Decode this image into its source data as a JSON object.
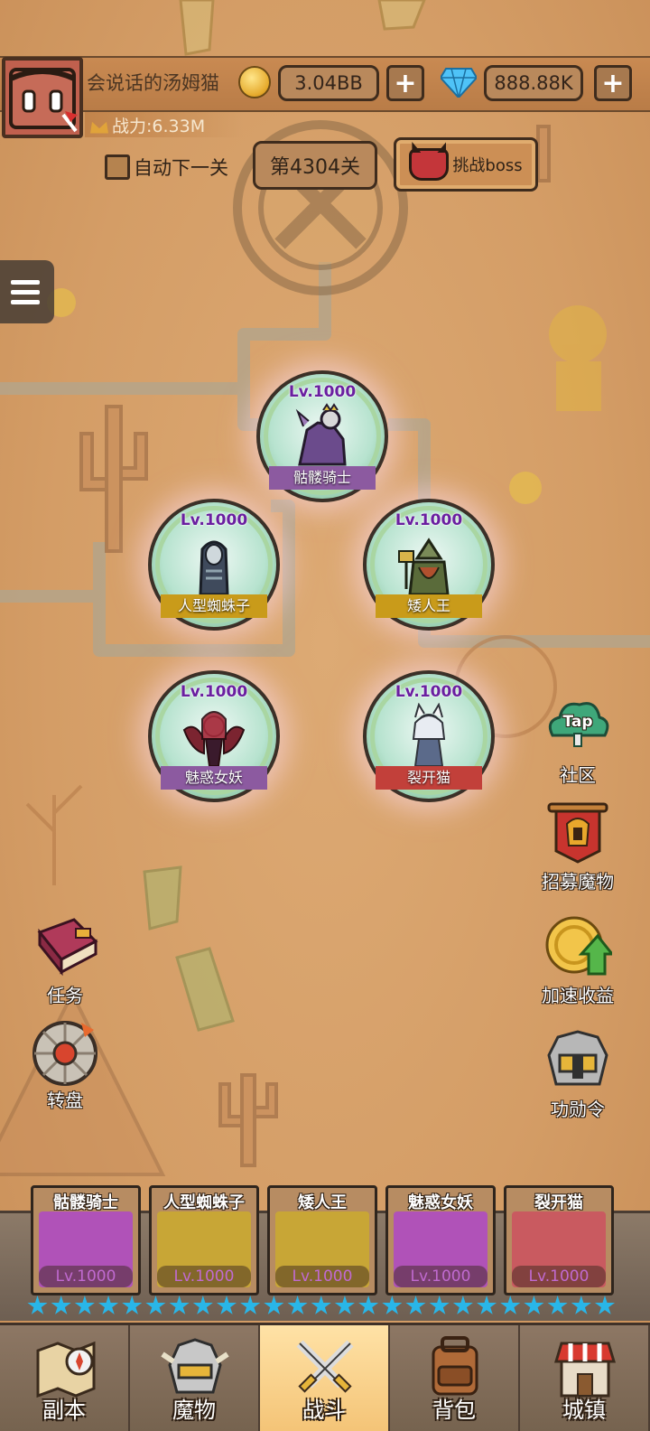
{
  "player": {
    "name": "会说话的汤姆猫",
    "power": "战力:6.33M",
    "gold": "3.04BB",
    "gems": "888.88K",
    "plus": "+"
  },
  "stage": {
    "auto_next_label": "自动下一关",
    "current": "第4304关",
    "boss_label": "挑战boss"
  },
  "heroes": [
    {
      "level": "Lv.1000",
      "name": "骷髅骑士",
      "banner_color": "#8c5aa0"
    },
    {
      "level": "Lv.1000",
      "name": "人型蜘蛛子",
      "banner_color": "#c99b1a"
    },
    {
      "level": "Lv.1000",
      "name": "矮人王",
      "banner_color": "#c99b1a"
    },
    {
      "level": "Lv.1000",
      "name": "魅惑女妖",
      "banner_color": "#8c5aa0"
    },
    {
      "level": "Lv.1000",
      "name": "裂开猫",
      "banner_color": "#c2403a"
    }
  ],
  "side_right": [
    {
      "label": "社区",
      "icon": "tap-cloud-icon",
      "icon_text": "Tap"
    },
    {
      "label": "招募魔物",
      "icon": "recruit-banner-icon"
    },
    {
      "label": "加速收益",
      "icon": "gold-coin-arrow-icon"
    },
    {
      "label": "功勋令",
      "icon": "helmet-medal-icon"
    }
  ],
  "side_left": [
    {
      "label": "任务",
      "icon": "quest-book-icon"
    },
    {
      "label": "转盘",
      "icon": "wheel-icon"
    }
  ],
  "team": [
    {
      "name": "骷髅骑士",
      "level": "Lv.1000",
      "color": "#b052b8",
      "stars": 5
    },
    {
      "name": "人型蜘蛛子",
      "level": "Lv.1000",
      "color": "#c8a636",
      "stars": 5
    },
    {
      "name": "矮人王",
      "level": "Lv.1000",
      "color": "#c8a636",
      "stars": 5
    },
    {
      "name": "魅惑女妖",
      "level": "Lv.1000",
      "color": "#b052b8",
      "stars": 5
    },
    {
      "name": "裂开猫",
      "level": "Lv.1000",
      "color": "#c95a60",
      "stars": 5
    }
  ],
  "nav": [
    {
      "label": "副本",
      "icon": "map-compass-icon",
      "active": false
    },
    {
      "label": "魔物",
      "icon": "monster-helmet-icon",
      "active": false
    },
    {
      "label": "战斗",
      "icon": "crossed-swords-icon",
      "active": true
    },
    {
      "label": "背包",
      "icon": "backpack-icon",
      "active": false
    },
    {
      "label": "城镇",
      "icon": "town-shop-icon",
      "active": false
    }
  ]
}
